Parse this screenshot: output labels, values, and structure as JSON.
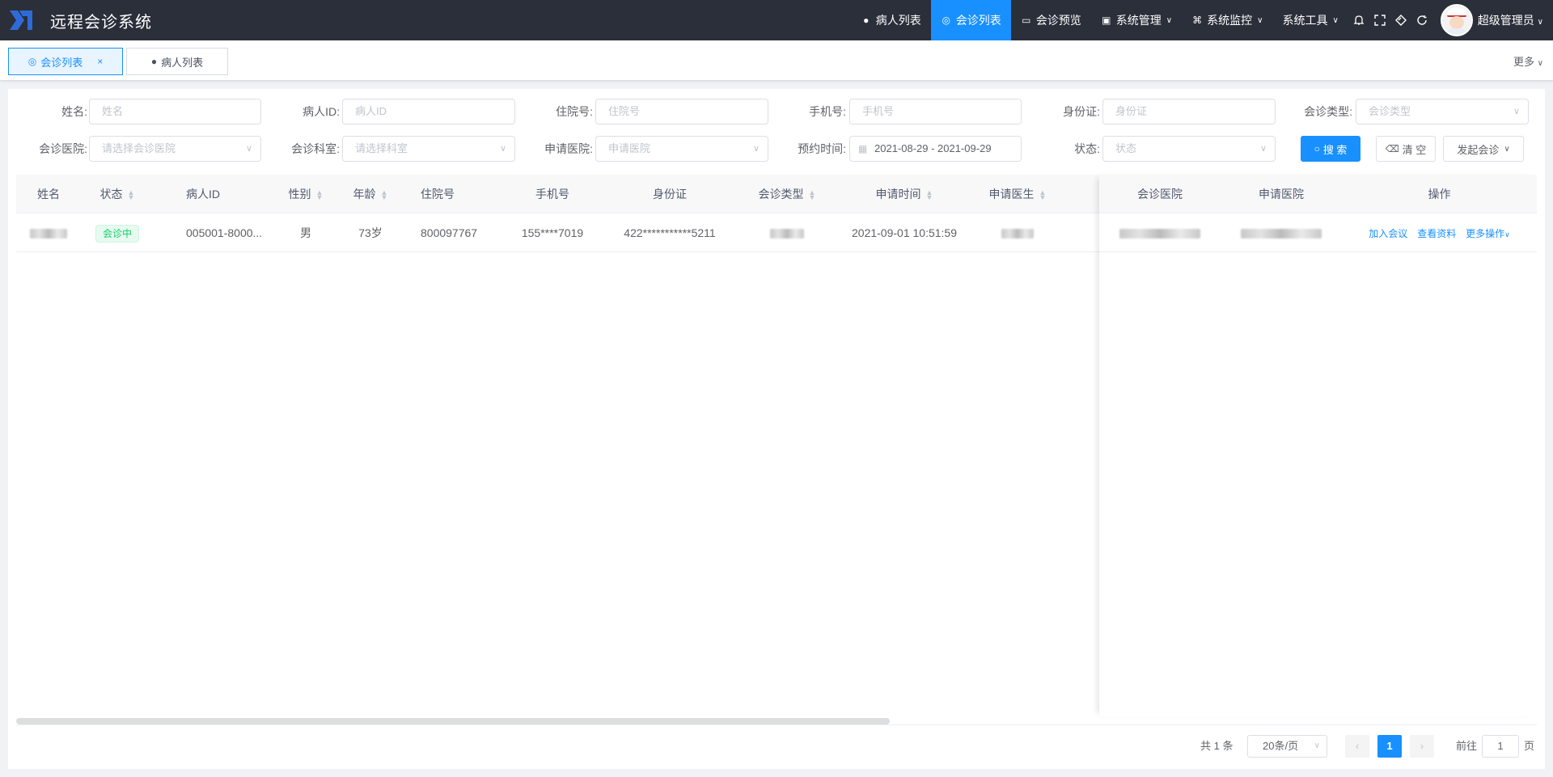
{
  "app": {
    "title": "远程会诊系统"
  },
  "nav": {
    "items": [
      {
        "label": "病人列表",
        "icon": "user-circle-icon"
      },
      {
        "label": "会诊列表",
        "icon": "aperture-icon",
        "active": true
      },
      {
        "label": "会诊预览",
        "icon": "monitor-icon"
      },
      {
        "label": "系统管理",
        "icon": "settings-box-icon",
        "dropdown": true
      },
      {
        "label": "系统监控",
        "icon": "command-icon",
        "dropdown": true
      },
      {
        "label": "系统工具",
        "dropdown": true
      }
    ],
    "user_name": "超级管理员"
  },
  "tags": [
    {
      "label": "会诊列表",
      "active": true
    },
    {
      "label": "病人列表",
      "active": false
    }
  ],
  "tags_more": "更多",
  "search": {
    "name_label": "姓名:",
    "name_placeholder": "姓名",
    "pid_label": "病人ID:",
    "pid_placeholder": "病人ID",
    "inpatient_label": "住院号:",
    "inpatient_placeholder": "住院号",
    "phone_label": "手机号:",
    "phone_placeholder": "手机号",
    "idcard_label": "身份证:",
    "idcard_placeholder": "身份证",
    "ctype_label": "会诊类型:",
    "ctype_placeholder": "会诊类型",
    "chospital_label": "会诊医院:",
    "chospital_placeholder": "请选择会诊医院",
    "cdept_label": "会诊科室:",
    "cdept_placeholder": "请选择科室",
    "ahospital_label": "申请医院:",
    "ahospital_placeholder": "申请医院",
    "appt_label": "预约时间:",
    "appt_value": "2021-08-29  - 2021-09-29",
    "status_label": "状态:",
    "status_placeholder": "状态",
    "search_btn": "搜 索",
    "clear_btn": "清 空",
    "start_btn": "发起会诊"
  },
  "table": {
    "headers": [
      "姓名",
      "状态",
      "病人ID",
      "性别",
      "年龄",
      "住院号",
      "手机号",
      "身份证",
      "会诊类型",
      "申请时间",
      "申请医生",
      "会诊医院",
      "申请医院",
      "操作"
    ],
    "rows": [
      {
        "status": "会诊中",
        "pid": "005001-8000...",
        "gender": "男",
        "age": "73岁",
        "inpatient": "800097767",
        "phone": "155****7019",
        "idcard": "422***********5211",
        "apply_time": "2021-09-01 10:51:59"
      }
    ],
    "ops": {
      "join": "加入会议",
      "view": "查看资料",
      "more": "更多操作"
    }
  },
  "pager": {
    "total": "共 1 条",
    "size": "20条/页",
    "current": "1",
    "goto_label": "前往",
    "goto_value": "1",
    "page_unit": "页"
  }
}
